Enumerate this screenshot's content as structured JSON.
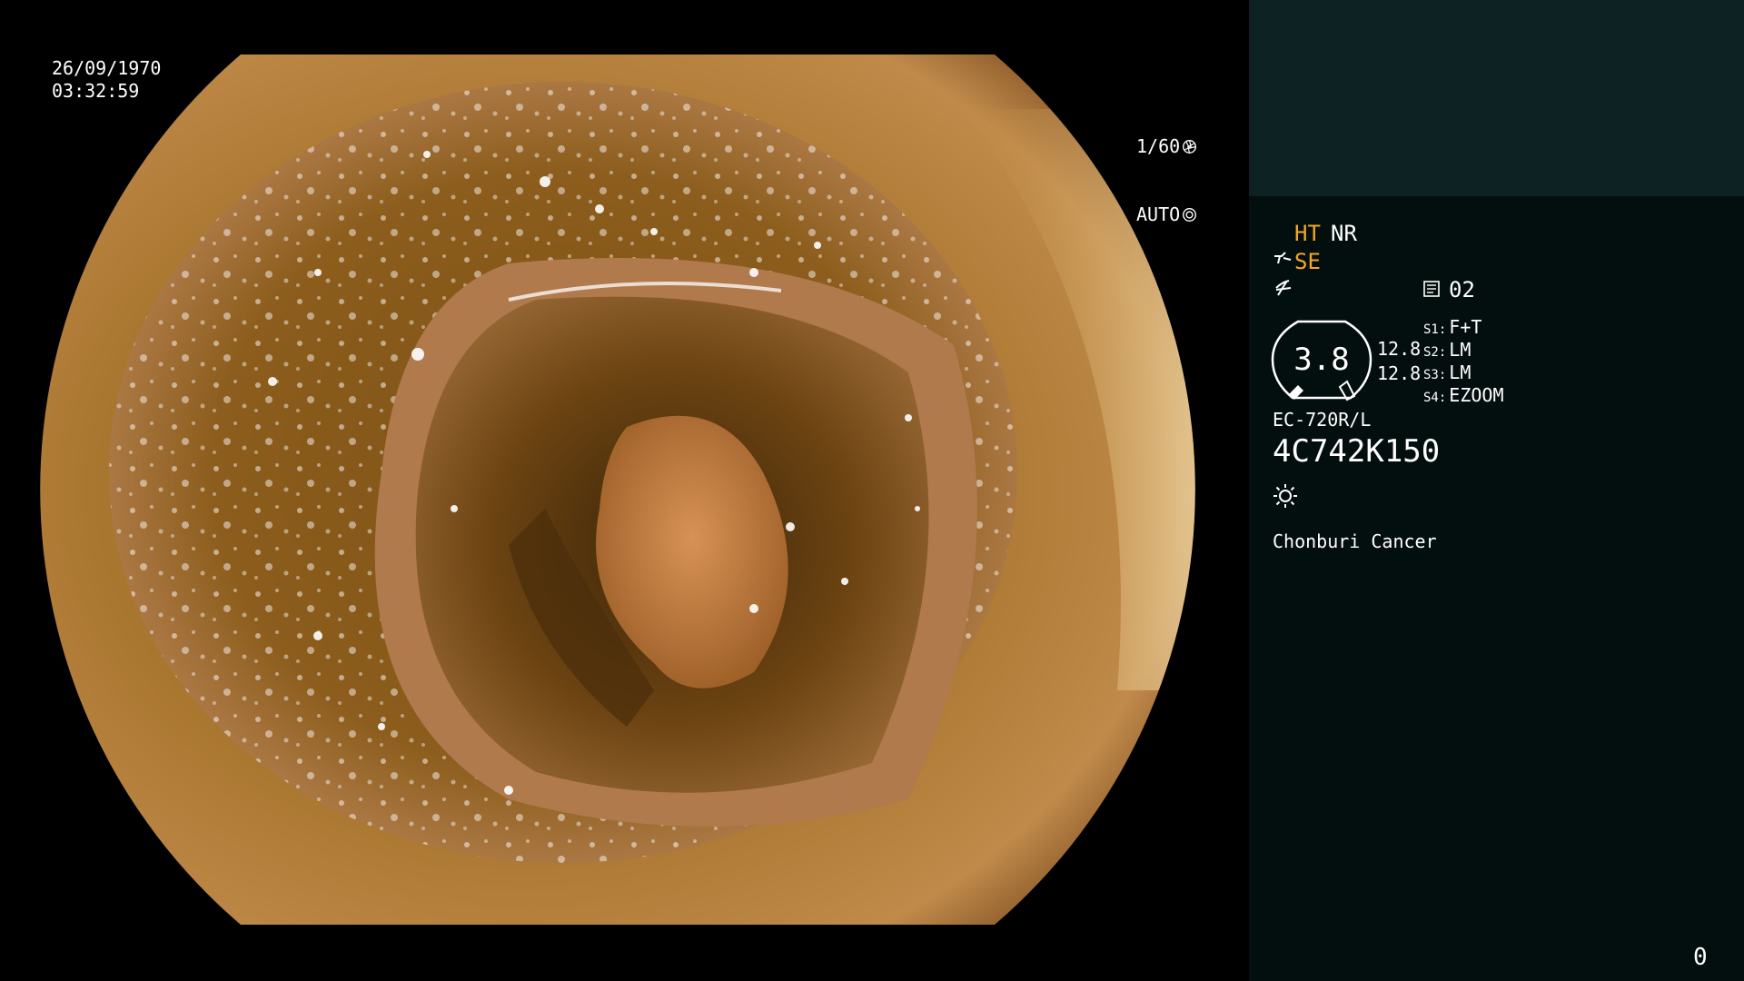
{
  "endoscope_view": {
    "date": "26/09/1970",
    "time": "03:32:59",
    "shutter_speed": "1/60",
    "exposure_mode": "AUTO",
    "shutter_icon": "aperture-icon",
    "auto_icon": "iris-icon"
  },
  "panel": {
    "enhance_mode": "HT",
    "noise_reduction": "NR",
    "structure_enhance": "SE",
    "record_icon": "record-card-icon",
    "record_number": "02",
    "zoom_value": "3.8",
    "value_a": "12.8",
    "value_b": "12.8",
    "switches": [
      {
        "label": "S1:",
        "value": "F+T"
      },
      {
        "label": "S2:",
        "value": "LM"
      },
      {
        "label": "S3:",
        "value": "LM"
      },
      {
        "label": "S4:",
        "value": "EZOOM"
      }
    ],
    "scope_model": "EC-720R/L",
    "scope_serial": "4C742K150",
    "light_icon": "sun-icon",
    "hospital": "Chonburi Cancer",
    "counter": "0"
  },
  "colors": {
    "accent": "#f5a623",
    "panel_bg": "#030f0e",
    "panel_top_bg": "#0d2223"
  }
}
